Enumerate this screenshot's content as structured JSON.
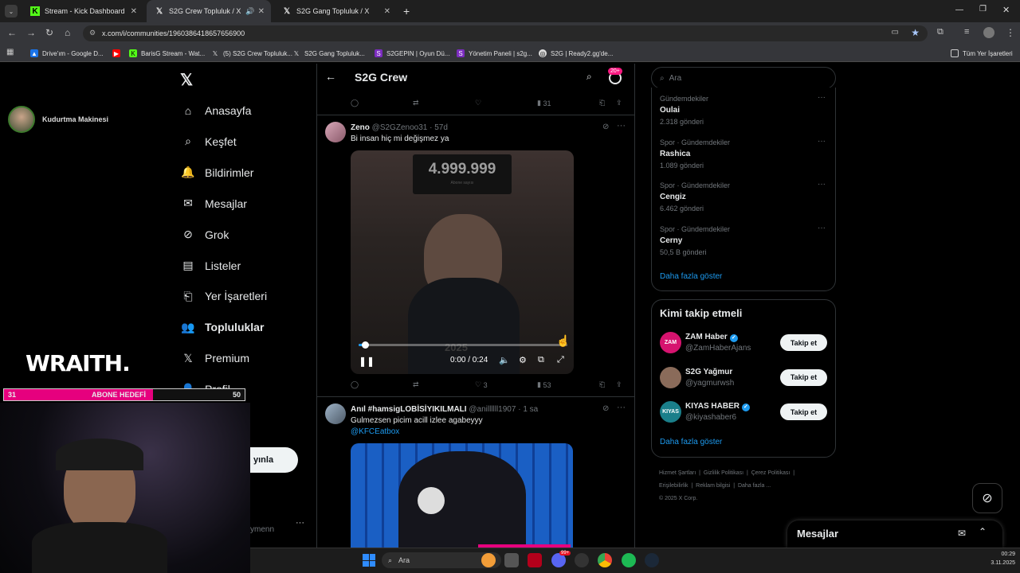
{
  "browser": {
    "tabs": [
      {
        "label": "Stream - Kick Dashboard"
      },
      {
        "label": "S2G Crew Topluluk / X"
      },
      {
        "label": "S2G Gang Topluluk / X"
      }
    ],
    "url": "x.com/i/communities/1960386418657656900",
    "bookmarks": [
      "Drive'ım - Google D...",
      "BarisG Stream - Wat...",
      "(5) S2G Crew Topluluk...",
      "S2G Gang Topluluk...",
      "S2GEPIN | Oyun Dü...",
      "Yönetim Paneli | s2g...",
      "S2G | Ready2.gg'de..."
    ],
    "all_bookmarks": "Tüm Yer İşaretleri"
  },
  "stream_overlay": {
    "channel_name": "Kudurtma Makinesi",
    "sponsor": "WRAITH.",
    "goal_current": "31",
    "goal_label": "ABONE HEDEFİ",
    "goal_target": "50",
    "goal_progress": 0.62,
    "behind_button": "yınla",
    "behind_user": "ymenn"
  },
  "nav": {
    "items": [
      {
        "label": "Anasayfa",
        "icon": "home-icon"
      },
      {
        "label": "Keşfet",
        "icon": "search-icon"
      },
      {
        "label": "Bildirimler",
        "icon": "bell-icon"
      },
      {
        "label": "Mesajlar",
        "icon": "mail-icon"
      },
      {
        "label": "Grok",
        "icon": "grok-icon"
      },
      {
        "label": "Listeler",
        "icon": "list-icon"
      },
      {
        "label": "Yer İşaretleri",
        "icon": "bookmark-icon"
      },
      {
        "label": "Topluluklar",
        "icon": "communities-icon"
      },
      {
        "label": "Premium",
        "icon": "x-icon"
      },
      {
        "label": "Profil",
        "icon": "person-icon"
      }
    ]
  },
  "header": {
    "title": "S2G Crew",
    "notif_badge": "20+"
  },
  "top_actions": {
    "views": "31"
  },
  "post1": {
    "name": "Zeno",
    "handle": "@S2GZenoo31",
    "time": "· 57d",
    "text": "Bi insan hiç mi değişmez ya",
    "video": {
      "counter": "4.999.999",
      "counter_sub": "Abone sayısı",
      "overlay_year": "2025",
      "time": "0:00 / 0:24",
      "progress": 0.03
    },
    "likes": "3",
    "views": "53"
  },
  "post2": {
    "name": "Anıl #hamsigLOBİSİYIKILMALI",
    "handle": "@anillllll1907",
    "time": "· 1 sa",
    "text": "Gulmezsen picim acill izlee agabeyyy",
    "mention": "@KFCEatbox"
  },
  "search": {
    "placeholder": "Ara"
  },
  "trends": {
    "items": [
      {
        "category": "Gündemdekiler",
        "name": "Oulai",
        "count": "2.318 gönderi"
      },
      {
        "category": "Spor · Gündemdekiler",
        "name": "Rashica",
        "count": "1.089 gönderi"
      },
      {
        "category": "Spor · Gündemdekiler",
        "name": "Cengiz",
        "count": "6.462 gönderi"
      },
      {
        "category": "Spor · Gündemdekiler",
        "name": "Cerny",
        "count": "50,5 B gönderi"
      }
    ],
    "show_more": "Daha fazla göster"
  },
  "who_to_follow": {
    "title": "Kimi takip etmeli",
    "items": [
      {
        "name": "ZAM Haber",
        "handle": "@ZamHaberAjans",
        "avatar_text": "ZAM",
        "avatar_color": "#d6136f",
        "verified": true,
        "button": "Takip et"
      },
      {
        "name": "S2G Yağmur",
        "handle": "@yagmurwsh",
        "avatar_text": "",
        "avatar_color": "#8a6b5a",
        "verified": false,
        "button": "Takip et"
      },
      {
        "name": "KIYAS HABER",
        "handle": "@kiyashaber6",
        "avatar_text": "KIYAS",
        "avatar_color": "#1a7f8a",
        "verified": true,
        "button": "Takip et"
      }
    ],
    "show_more": "Daha fazla göster"
  },
  "footer": {
    "links": [
      "Hizmet Şartları",
      "Gizlilik Politikası",
      "Çerez Politikası",
      "Erişilebilirlik",
      "Reklam bilgisi",
      "Daha fazla ..."
    ],
    "copyright": "© 2025 X Corp."
  },
  "messages_dock": {
    "label": "Mesajlar"
  },
  "taskbar": {
    "search": "Ara",
    "time": "00:29",
    "date": "3.11.2025",
    "icon_badge": "99+"
  },
  "colors": {
    "accent": "#1d9bf0",
    "pink": "#f91880",
    "goal_pink": "#e6007e"
  }
}
